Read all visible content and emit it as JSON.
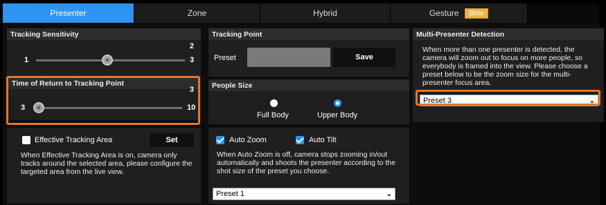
{
  "tabs": [
    {
      "label": "Presenter",
      "active": true
    },
    {
      "label": "Zone",
      "active": false
    },
    {
      "label": "Hybrid",
      "active": false
    },
    {
      "label": "Gesture",
      "active": false,
      "badge": "Beta"
    },
    {
      "label": "",
      "active": false
    }
  ],
  "tracking_sensitivity": {
    "title": "Tracking Sensitivity",
    "current": "2",
    "min": "1",
    "max": "3",
    "value": 2
  },
  "return_time": {
    "title": "Time of Return to Tracking Point",
    "current": "3",
    "min": "3",
    "max": "10",
    "value": 3
  },
  "effective_area": {
    "checkbox_label": "Effective Tracking Area",
    "checked": false,
    "set_label": "Set",
    "description": "When Effective Tracking Area is on, camera only tracks around the selected area, please configure the targeted area from the live view."
  },
  "tracking_point": {
    "title": "Tracking Point",
    "preset_label": "Preset",
    "save_label": "Save"
  },
  "people_size": {
    "title": "People Size",
    "options": [
      "Full Body",
      "Upper Body"
    ],
    "selected": "Upper Body"
  },
  "auto": {
    "zoom_label": "Auto Zoom",
    "zoom_checked": true,
    "tilt_label": "Auto Tilt",
    "tilt_checked": true,
    "description": "When Auto Zoom is off, camera stops zooming in/out automatically and shoots the presenter according to the shot size of the preset you choose.",
    "preset_value": "Preset 1"
  },
  "multi_presenter": {
    "title": "Multi-Presenter Detection",
    "description": "When more than one presenter is detected, the camera will zoom out to focus on more people, so everybody is framed into the view. Please choose a preset below to be the zoom size for the multi-presenter focus area.",
    "preset_value": "Preset 3"
  },
  "colors": {
    "accent": "#2f94f0",
    "highlight": "#e8762a",
    "beta": "#f5b33c"
  }
}
